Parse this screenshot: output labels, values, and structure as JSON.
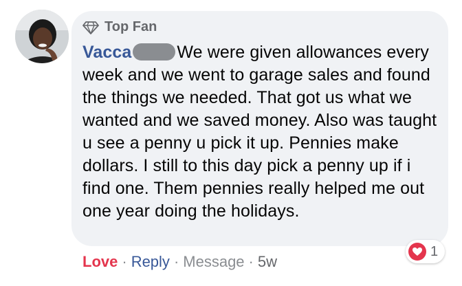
{
  "comment": {
    "badge_label": "Top Fan",
    "author": "Vacca",
    "text": "We were given allowances every week and we went to garage sales and found the things we needed. That got us what we wanted and we saved money. Also was taught u see a penny u pick it up. Pennies make dollars. I still to this day pick a penny up if i find one. Them pennies really helped me out one year doing the holidays.",
    "reaction_icon": "love-heart-icon",
    "reaction_count": "1"
  },
  "actions": {
    "love": "Love",
    "reply": "Reply",
    "message": "Message",
    "timestamp": "5w",
    "separator": "·"
  },
  "colors": {
    "bubble_bg": "#f0f2f5",
    "author": "#385898",
    "love": "#e4354d",
    "muted": "#65676b"
  }
}
